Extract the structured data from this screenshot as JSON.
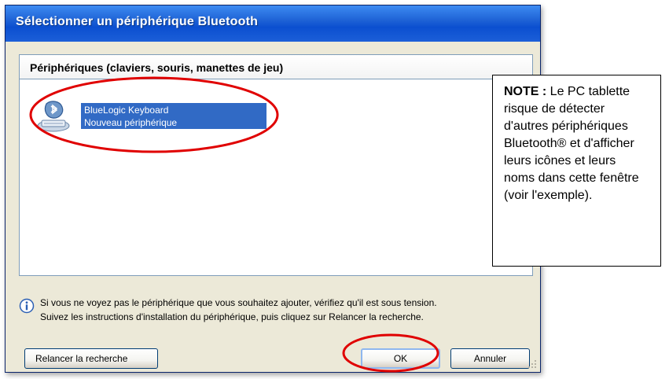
{
  "dialog": {
    "title": "Sélectionner un périphérique Bluetooth",
    "panel_header": "Périphériques (claviers, souris, manettes de jeu)",
    "device": {
      "name": "BlueLogic Keyboard",
      "status": "Nouveau périphérique",
      "icon": "bluetooth-keyboard-icon"
    },
    "info": {
      "icon": "info-icon",
      "line1": "Si vous ne voyez pas le périphérique que vous souhaitez ajouter, vérifiez qu'il est sous tension.",
      "line2": "Suivez les instructions d'installation du périphérique, puis cliquez sur Relancer la recherche."
    },
    "buttons": {
      "rescan": "Relancer la recherche",
      "ok": "OK",
      "cancel": "Annuler"
    }
  },
  "note": {
    "label": "NOTE :",
    "text": "Le PC tablette risque de détecter d'autres périphériques Bluetooth® et d'afficher leurs icônes et leurs noms dans cette fenêtre (voir l'exemple)."
  },
  "colors": {
    "titlebar": "#0b4fd0",
    "selection": "#316ac5",
    "highlight_ellipse": "#e00000"
  }
}
